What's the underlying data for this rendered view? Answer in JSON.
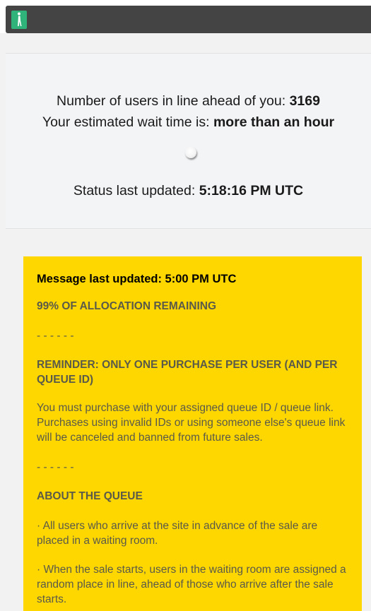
{
  "header": {
    "logo_icon": "walking-person-icon",
    "logo_color": "#2fb37a",
    "bar_color": "#444444"
  },
  "status": {
    "queue_label": "Number of users in line ahead of you:",
    "queue_count": "3169",
    "wait_label": "Your estimated wait time is:",
    "wait_value": "more than an hour",
    "spinner_icon": "loading-spinner-icon",
    "updated_label": "Status last updated:",
    "updated_value": "5:18:16 PM UTC"
  },
  "message": {
    "background": "#ffd700",
    "updated": "Message last updated: 5:00 PM UTC",
    "allocation": "99% OF ALLOCATION REMAINING",
    "divider_1": "- - - - - -",
    "reminder_title": "REMINDER: ONLY ONE PURCHASE PER USER (AND PER QUEUE ID)",
    "reminder_body": "You must purchase with your assigned queue ID / queue link. Purchases using invalid IDs or using someone else's queue link will be canceled and banned from future sales.",
    "divider_2": "- - - - - -",
    "about_title": "ABOUT THE QUEUE",
    "about_point_1": "· All users who arrive at the site in advance of the sale are placed in a waiting room.",
    "about_point_2": "· When the sale starts, users in the waiting room are assigned a random place in line, ahead of those who arrive after the sale starts."
  }
}
